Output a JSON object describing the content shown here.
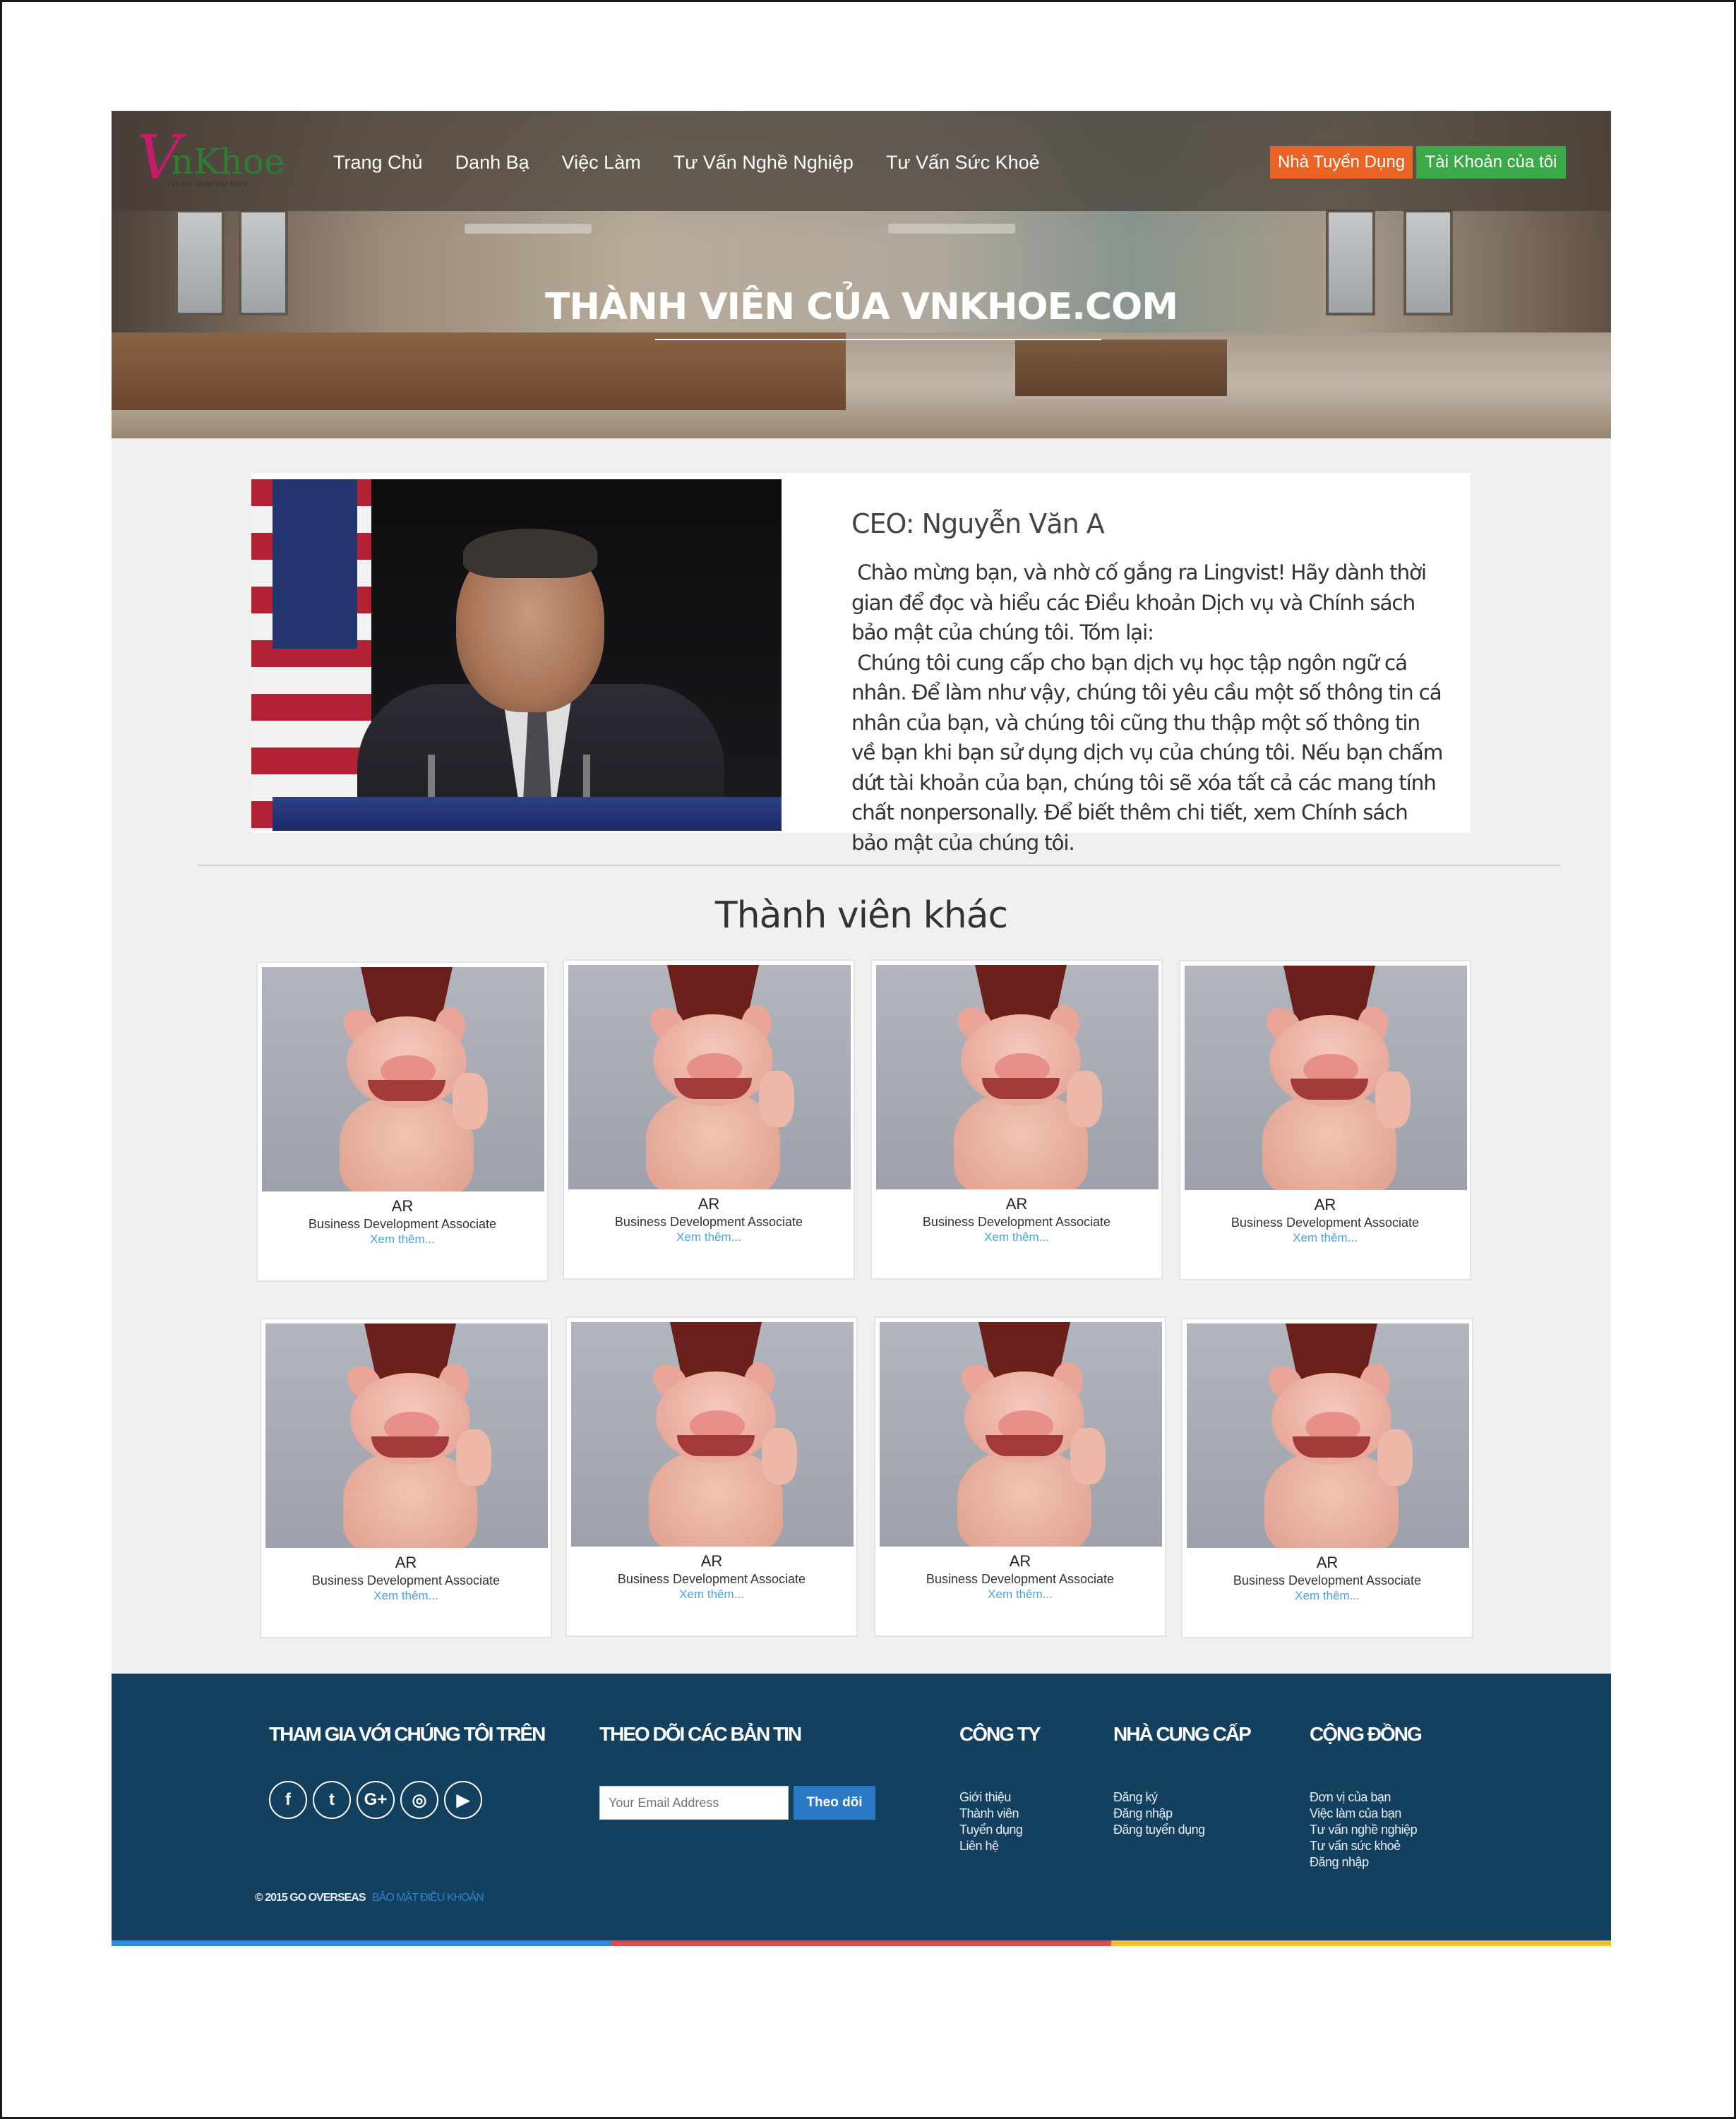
{
  "brand": {
    "logo_text_v": "V",
    "logo_text_rest": "nKhoe",
    "logo_tagline": "Vì sức khỏe Việt Nam"
  },
  "nav": {
    "items": [
      "Trang Chủ",
      "Danh Bạ",
      "Việc Làm",
      "Tư Vấn Nghề Nghiệp",
      "Tư Vấn Sức Khoẻ"
    ],
    "employer_button": "Nhà Tuyển Dụng",
    "account_button": "Tài Khoản của tôi"
  },
  "hero": {
    "title": "THÀNH VIÊN CỦA VNKHOE.COM"
  },
  "ceo": {
    "name": "CEO: Nguyễn Văn A",
    "bio": " Chào mừng bạn, và nhờ cố gắng ra Lingvist! Hãy dành thời gian để đọc và hiểu các Điều khoản Dịch vụ và Chính sách bảo mật của chúng tôi. Tóm lại:\n Chúng tôi cung cấp cho bạn dịch vụ học tập ngôn ngữ cá nhân. Để làm như vậy, chúng tôi yêu cầu một số thông tin cá nhân của bạn, và chúng tôi cũng thu thập một số thông tin về bạn khi bạn sử dụng dịch vụ của chúng tôi. Nếu bạn chấm dứt tài khoản của bạn, chúng tôi sẽ xóa tất cả các mang tính chất nonpersonally. Để biết thêm chi tiết, xem Chính sách bảo mật của chúng tôi."
  },
  "others": {
    "title": "Thành viên khác",
    "members": [
      {
        "name": "AR",
        "role": "Business Development Associate",
        "more": "Xem thêm..."
      },
      {
        "name": "AR",
        "role": "Business Development Associate",
        "more": "Xem thêm..."
      },
      {
        "name": "AR",
        "role": "Business Development Associate",
        "more": "Xem thêm..."
      },
      {
        "name": "AR",
        "role": "Business Development Associate",
        "more": "Xem thêm..."
      },
      {
        "name": "AR",
        "role": "Business Development Associate",
        "more": "Xem thêm..."
      },
      {
        "name": "AR",
        "role": "Business Development Associate",
        "more": "Xem thêm..."
      },
      {
        "name": "AR",
        "role": "Business Development Associate",
        "more": "Xem thêm..."
      },
      {
        "name": "AR",
        "role": "Business Development Associate",
        "more": "Xem thêm..."
      }
    ]
  },
  "footer": {
    "join_title": "THAM GIA VỚI CHÚNG TÔI TRÊN",
    "social_icons": [
      "facebook-icon",
      "twitter-icon",
      "google-plus-icon",
      "instagram-icon",
      "youtube-icon"
    ],
    "social_glyphs": [
      "f",
      "t",
      "G+",
      "◎",
      "▶"
    ],
    "newsletter_title": "THEO DÕI CÁC BẢN TIN",
    "email_placeholder": "Your Email Address",
    "subscribe_label": "Theo dõi",
    "company_title": "CÔNG TY",
    "company_links": [
      "Giới thiệu",
      "Thành viên",
      "Tuyển dụng",
      "Liên hệ"
    ],
    "provider_title": "NHÀ CUNG CẤP",
    "provider_links": [
      "Đăng ký",
      "Đăng nhập",
      "Đăng tuyển dụng"
    ],
    "community_title": "CỘNG ĐỒNG",
    "community_links": [
      "Đơn vị của bạn",
      "Việc làm của bạn",
      "Tư vấn nghề nghiệp",
      "Tư vấn sức khoẻ",
      "Đăng nhập"
    ],
    "copyright": "© 2015 GO OVERSEAS",
    "terms": "BẢO MẬT ĐIỀU KHOẢN"
  },
  "colors": {
    "accent_orange": "#ea6325",
    "accent_green": "#3aaa48",
    "footer_bg": "#13405f",
    "link_blue": "#4aa3df",
    "stripe_blue": "#2b8fd6",
    "stripe_red": "#e04b4b",
    "stripe_yellow": "#f2c12e"
  }
}
